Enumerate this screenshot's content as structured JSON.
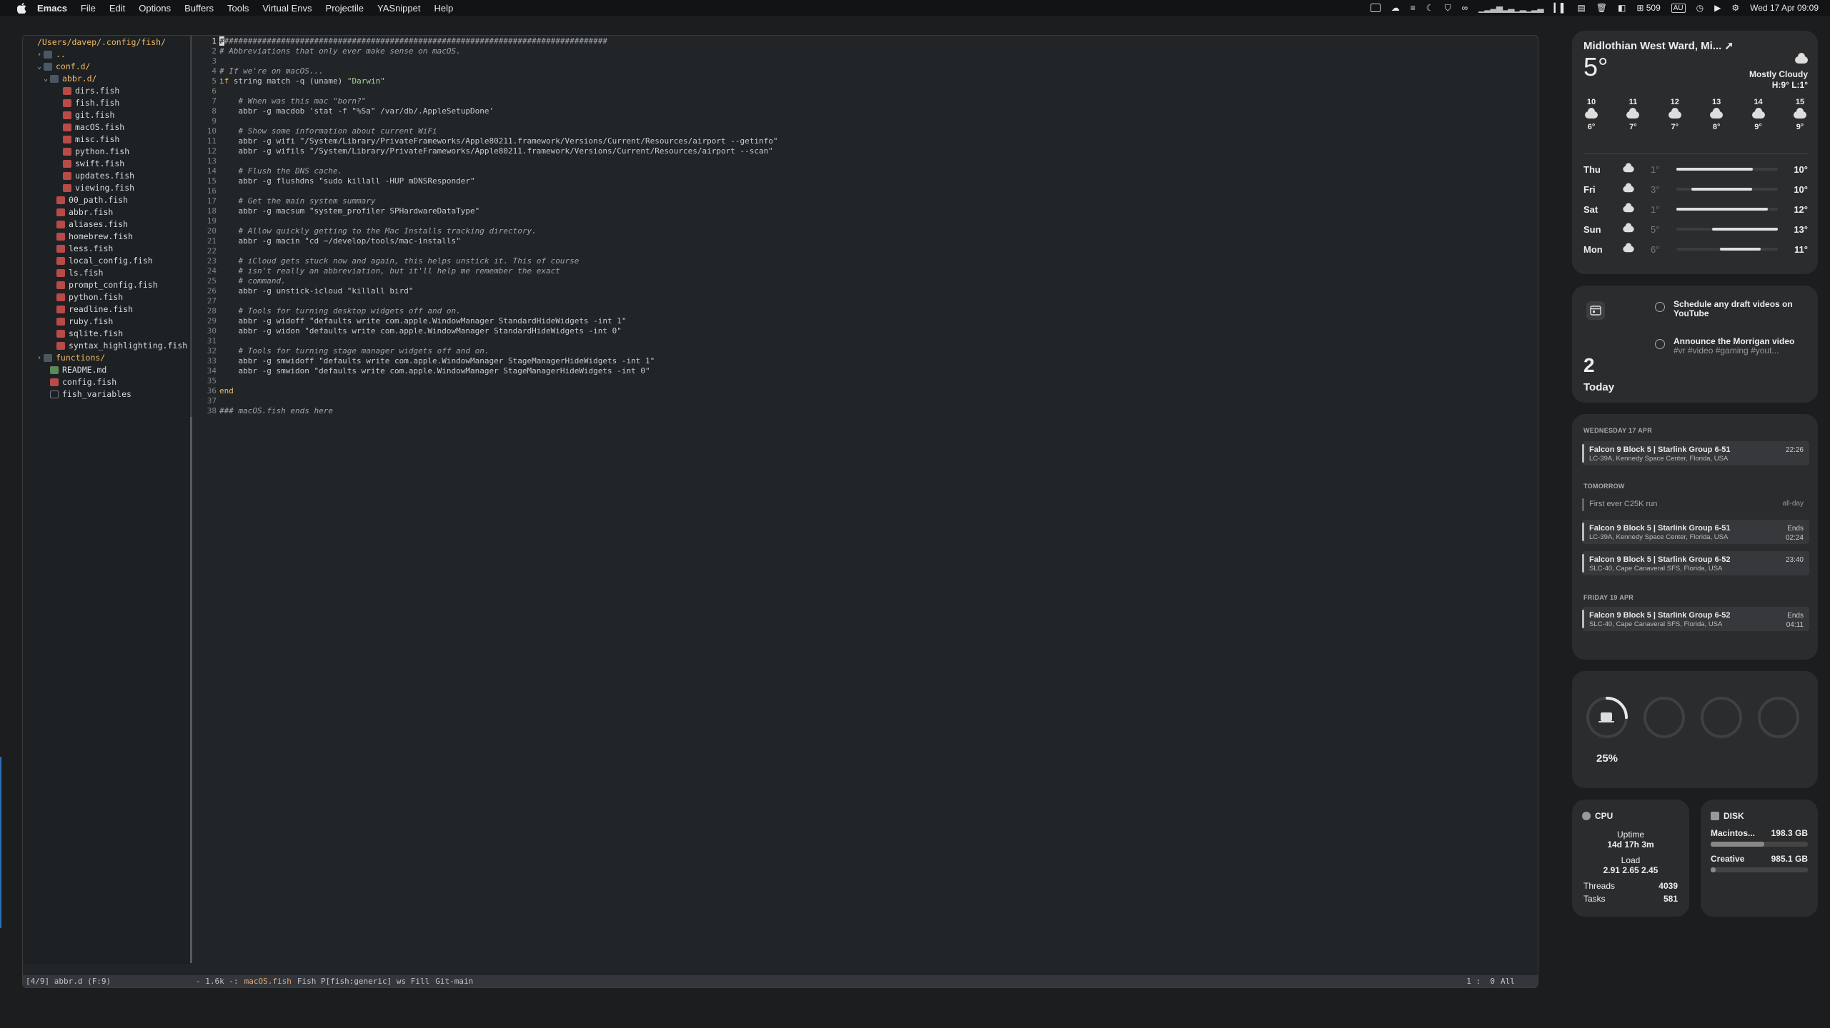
{
  "menubar": {
    "app": "Emacs",
    "items": [
      "File",
      "Edit",
      "Options",
      "Buffers",
      "Tools",
      "Virtual Envs",
      "Projectile",
      "YASnippet",
      "Help"
    ],
    "right": {
      "notifications": "509",
      "keyboard": "AU",
      "datetime": "Wed 17 Apr  09:09"
    }
  },
  "tree": {
    "rows": [
      {
        "indent": 0,
        "arrow": "",
        "icon": "dir",
        "text": "/Users/davep/.config/fish/",
        "cls": "dir"
      },
      {
        "indent": 1,
        "arrow": "›",
        "icon": "dir",
        "text": "..",
        "cls": "dir"
      },
      {
        "indent": 1,
        "arrow": "⌄",
        "icon": "dir",
        "text": "conf.d/",
        "cls": "dir"
      },
      {
        "indent": 2,
        "arrow": "⌄",
        "icon": "dir",
        "text": "abbr.d/",
        "cls": "dir"
      },
      {
        "indent": 4,
        "arrow": "",
        "icon": "fish",
        "text": "dirs.fish",
        "cls": "file"
      },
      {
        "indent": 4,
        "arrow": "",
        "icon": "fish",
        "text": "fish.fish",
        "cls": "file"
      },
      {
        "indent": 4,
        "arrow": "",
        "icon": "fish",
        "text": "git.fish",
        "cls": "file"
      },
      {
        "indent": 4,
        "arrow": "",
        "icon": "fish",
        "text": "macOS.fish",
        "cls": "file"
      },
      {
        "indent": 4,
        "arrow": "",
        "icon": "fish",
        "text": "misc.fish",
        "cls": "file"
      },
      {
        "indent": 4,
        "arrow": "",
        "icon": "fish",
        "text": "python.fish",
        "cls": "file"
      },
      {
        "indent": 4,
        "arrow": "",
        "icon": "fish",
        "text": "swift.fish",
        "cls": "file"
      },
      {
        "indent": 4,
        "arrow": "",
        "icon": "fish",
        "text": "updates.fish",
        "cls": "file"
      },
      {
        "indent": 4,
        "arrow": "",
        "icon": "fish",
        "text": "viewing.fish",
        "cls": "file"
      },
      {
        "indent": 3,
        "arrow": "",
        "icon": "fish",
        "text": "00_path.fish",
        "cls": "file"
      },
      {
        "indent": 3,
        "arrow": "",
        "icon": "fish",
        "text": "abbr.fish",
        "cls": "file"
      },
      {
        "indent": 3,
        "arrow": "",
        "icon": "fish",
        "text": "aliases.fish",
        "cls": "file"
      },
      {
        "indent": 3,
        "arrow": "",
        "icon": "fish",
        "text": "homebrew.fish",
        "cls": "file"
      },
      {
        "indent": 3,
        "arrow": "",
        "icon": "fish",
        "text": "less.fish",
        "cls": "file"
      },
      {
        "indent": 3,
        "arrow": "",
        "icon": "fish",
        "text": "local_config.fish",
        "cls": "file"
      },
      {
        "indent": 3,
        "arrow": "",
        "icon": "fish",
        "text": "ls.fish",
        "cls": "file"
      },
      {
        "indent": 3,
        "arrow": "",
        "icon": "fish",
        "text": "prompt_config.fish",
        "cls": "file"
      },
      {
        "indent": 3,
        "arrow": "",
        "icon": "fish",
        "text": "python.fish",
        "cls": "file"
      },
      {
        "indent": 3,
        "arrow": "",
        "icon": "fish",
        "text": "readline.fish",
        "cls": "file"
      },
      {
        "indent": 3,
        "arrow": "",
        "icon": "fish",
        "text": "ruby.fish",
        "cls": "file"
      },
      {
        "indent": 3,
        "arrow": "",
        "icon": "fish",
        "text": "sqlite.fish",
        "cls": "file"
      },
      {
        "indent": 3,
        "arrow": "",
        "icon": "fish",
        "text": "syntax_highlighting.fish",
        "cls": "file"
      },
      {
        "indent": 1,
        "arrow": "›",
        "icon": "dir",
        "text": "functions/",
        "cls": "dir"
      },
      {
        "indent": 2,
        "arrow": "",
        "icon": "md",
        "text": "README.md",
        "cls": "file"
      },
      {
        "indent": 2,
        "arrow": "",
        "icon": "fish",
        "text": "config.fish",
        "cls": "file"
      },
      {
        "indent": 2,
        "arrow": "",
        "icon": "plain",
        "text": "fish_variables",
        "cls": "file"
      }
    ]
  },
  "editor": {
    "lines": [
      {
        "t": "##################################################################################",
        "k": "cm"
      },
      {
        "t": "# Abbreviations that only ever make sense on macOS.",
        "k": "cm"
      },
      {
        "t": "",
        "k": ""
      },
      {
        "t": "# If we're on macOS...",
        "k": "cm"
      },
      {
        "t": "if string match -q (uname) \"Darwin\"",
        "k": "mix"
      },
      {
        "t": "",
        "k": ""
      },
      {
        "t": "    # When was this mac \"born?\"",
        "k": "cm"
      },
      {
        "t": "    abbr -g macdob 'stat -f \"%Sa\" /var/db/.AppleSetupDone'",
        "k": ""
      },
      {
        "t": "",
        "k": ""
      },
      {
        "t": "    # Show some information about current WiFi",
        "k": "cm"
      },
      {
        "t": "    abbr -g wifi \"/System/Library/PrivateFrameworks/Apple80211.framework/Versions/Current/Resources/airport --getinfo\"",
        "k": ""
      },
      {
        "t": "    abbr -g wifils \"/System/Library/PrivateFrameworks/Apple80211.framework/Versions/Current/Resources/airport --scan\"",
        "k": ""
      },
      {
        "t": "",
        "k": ""
      },
      {
        "t": "    # Flush the DNS cache.",
        "k": "cm"
      },
      {
        "t": "    abbr -g flushdns \"sudo killall -HUP mDNSResponder\"",
        "k": ""
      },
      {
        "t": "",
        "k": ""
      },
      {
        "t": "    # Get the main system summary",
        "k": "cm"
      },
      {
        "t": "    abbr -g macsum \"system_profiler SPHardwareDataType\"",
        "k": ""
      },
      {
        "t": "",
        "k": ""
      },
      {
        "t": "    # Allow quickly getting to the Mac Installs tracking directory.",
        "k": "cm"
      },
      {
        "t": "    abbr -g macin \"cd ~/develop/tools/mac-installs\"",
        "k": ""
      },
      {
        "t": "",
        "k": ""
      },
      {
        "t": "    # iCloud gets stuck now and again, this helps unstick it. This of course",
        "k": "cm"
      },
      {
        "t": "    # isn't really an abbreviation, but it'll help me remember the exact",
        "k": "cm"
      },
      {
        "t": "    # command.",
        "k": "cm"
      },
      {
        "t": "    abbr -g unstick-icloud \"killall bird\"",
        "k": ""
      },
      {
        "t": "",
        "k": ""
      },
      {
        "t": "    # Tools for turning desktop widgets off and on.",
        "k": "cm"
      },
      {
        "t": "    abbr -g widoff \"defaults write com.apple.WindowManager StandardHideWidgets -int 1\"",
        "k": ""
      },
      {
        "t": "    abbr -g widon \"defaults write com.apple.WindowManager StandardHideWidgets -int 0\"",
        "k": ""
      },
      {
        "t": "",
        "k": ""
      },
      {
        "t": "    # Tools for turning stage manager widgets off and on.",
        "k": "cm"
      },
      {
        "t": "    abbr -g smwidoff \"defaults write com.apple.WindowManager StageManagerHideWidgets -int 1\"",
        "k": ""
      },
      {
        "t": "    abbr -g smwidon \"defaults write com.apple.WindowManager StageManagerHideWidgets -int 0\"",
        "k": ""
      },
      {
        "t": "",
        "k": ""
      },
      {
        "t": "end",
        "k": "kw"
      },
      {
        "t": "",
        "k": ""
      },
      {
        "t": "### macOS.fish ends here",
        "k": "cm"
      }
    ]
  },
  "modeline": {
    "left": "[4/9] abbr.d (F:9)",
    "state": "- 1.6k -:",
    "buffer": "macOS.fish",
    "mode": "Fish P[fish:generic] ws Fill",
    "vc": "Git-main",
    "position": "1 :  0",
    "scroll": "All"
  },
  "weather": {
    "location": "Midlothian West Ward, Mi...",
    "temp": "5°",
    "condition": "Mostly Cloudy",
    "hilo": "H:9° L:1°",
    "hourly": [
      {
        "time": "10",
        "temp": "6°"
      },
      {
        "time": "11",
        "temp": "7°"
      },
      {
        "time": "12",
        "temp": "7°"
      },
      {
        "time": "13",
        "temp": "8°"
      },
      {
        "time": "14",
        "temp": "9°"
      },
      {
        "time": "15",
        "temp": "9°"
      }
    ],
    "daily": [
      {
        "day": "Thu",
        "lo": "1°",
        "hi": "10°",
        "from": 0.0,
        "to": 0.75
      },
      {
        "day": "Fri",
        "lo": "3°",
        "hi": "10°",
        "from": 0.15,
        "to": 0.75
      },
      {
        "day": "Sat",
        "lo": "1°",
        "hi": "12°",
        "from": 0.0,
        "to": 0.9
      },
      {
        "day": "Sun",
        "lo": "5°",
        "hi": "13°",
        "from": 0.35,
        "to": 1.0
      },
      {
        "day": "Mon",
        "lo": "6°",
        "hi": "11°",
        "from": 0.43,
        "to": 0.83
      }
    ]
  },
  "reminders": {
    "count": "2",
    "label": "Today",
    "items": [
      {
        "title": "Schedule any draft videos on YouTube",
        "tags": ""
      },
      {
        "title": "Announce the Morrigan video",
        "tags": "#vr #video #gaming #yout..."
      }
    ]
  },
  "calendar": {
    "wed_header": "WEDNESDAY 17 APR",
    "tomorrow_header": "TOMORROW",
    "fri_header": "FRIDAY 19 APR",
    "events": [
      {
        "title": "Falcon 9 Block 5 | Starlink Group 6-51",
        "loc": "LC-39A, Kennedy Space Center, Florida, USA",
        "time": "22:26"
      },
      {
        "title": "First ever C25K run",
        "time": "all-day"
      },
      {
        "title": "Falcon 9 Block 5 | Starlink Group 6-51",
        "loc": "LC-39A, Kennedy Space Center, Florida, USA",
        "time": "Ends\n02:24"
      },
      {
        "title": "Falcon 9 Block 5 | Starlink Group 6-52",
        "loc": "SLC-40, Cape Canaveral SFS, Florida, USA",
        "time": "23:40"
      },
      {
        "title": "Falcon 9 Block 5 | Starlink Group 6-52",
        "loc": "SLC-40, Cape Canaveral SFS, Florida, USA",
        "time": "Ends\n04:11"
      }
    ]
  },
  "battery": {
    "percent": "25%",
    "level": 0.25
  },
  "cpu": {
    "title": "CPU",
    "uptime_label": "Uptime",
    "uptime": "14d 17h 3m",
    "load_label": "Load",
    "load": "2.91 2.65 2.45",
    "threads_label": "Threads",
    "threads": "4039",
    "tasks_label": "Tasks",
    "tasks": "581"
  },
  "disk": {
    "title": "DISK",
    "volumes": [
      {
        "name": "Macintos...",
        "free": "198.3 GB",
        "used": 0.55
      },
      {
        "name": "Creative",
        "free": "985.1 GB",
        "used": 0.05
      }
    ]
  }
}
